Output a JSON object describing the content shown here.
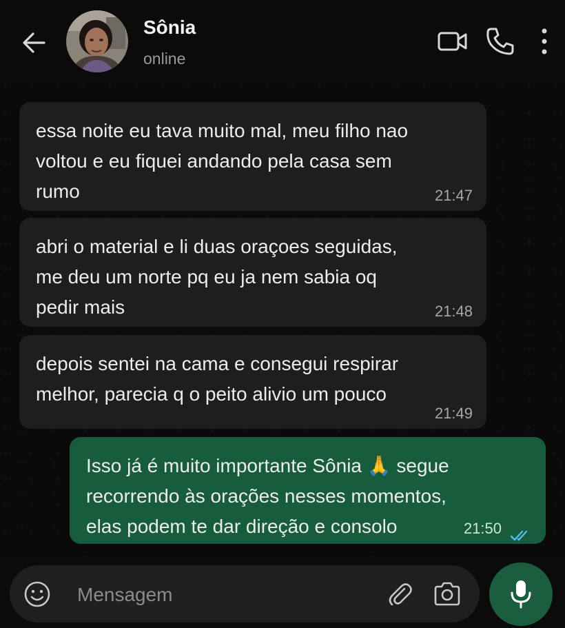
{
  "header": {
    "contact_name": "Sônia",
    "status": "online",
    "icons": [
      "back-arrow-icon",
      "avatar",
      "video-call-icon",
      "voice-call-icon",
      "more-vertical-icon"
    ]
  },
  "messages": [
    {
      "direction": "incoming",
      "text": "essa noite eu tava muito mal, meu filho nao\nvoltou e eu fiquei andando pela casa sem\nrumo",
      "time": "21:47"
    },
    {
      "direction": "incoming",
      "text": "abri o material e li duas oraçoes seguidas,\nme deu um norte pq eu ja nem sabia oq\npedir mais",
      "time": "21:48"
    },
    {
      "direction": "incoming",
      "text": "depois sentei na cama e consegui respirar\nmelhor, parecia q o peito alivio um pouco",
      "time": "21:49"
    },
    {
      "direction": "outgoing",
      "text": "Isso já é muito importante Sônia 🙏 segue\nrecorrendo às orações nesses momentos,\nelas podem te dar direção e consolo",
      "time": "21:50",
      "read": true
    }
  ],
  "composer": {
    "placeholder": "Mensagem",
    "icons": [
      "emoji-icon",
      "attach-icon",
      "camera-icon",
      "mic-icon"
    ]
  },
  "colors": {
    "incoming_bubble": "#1e1e1e",
    "outgoing_bubble": "#175c3c",
    "read_ticks": "#53bdeb",
    "mic_button": "#1a5e3f"
  }
}
